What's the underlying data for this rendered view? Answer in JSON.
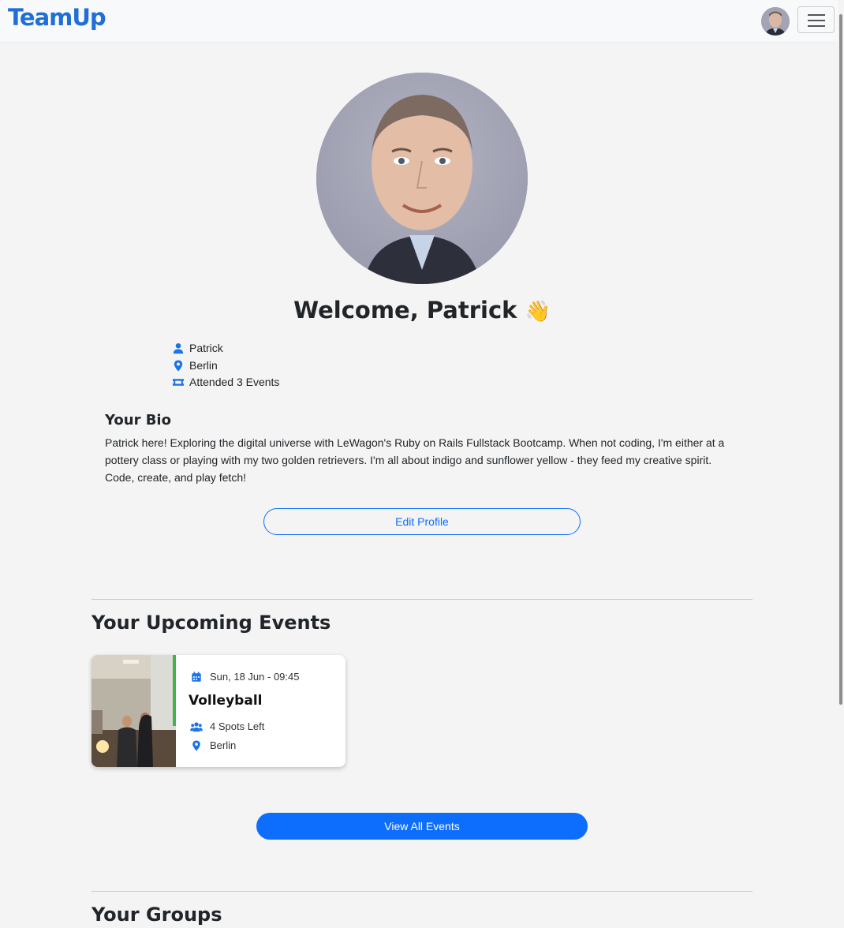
{
  "navbar": {
    "brand": "TeamUp"
  },
  "profile": {
    "welcome": "Welcome, Patrick",
    "wave_emoji": "👋",
    "info": [
      {
        "icon": "user-icon",
        "text": "Patrick"
      },
      {
        "icon": "location-pin-icon",
        "text": "Berlin"
      },
      {
        "icon": "ticket-icon",
        "text": "Attended 3 Events"
      }
    ],
    "bio_title": "Your Bio",
    "bio_text": "Patrick here! Exploring the digital universe with LeWagon's Ruby on Rails Fullstack Bootcamp. When not coding, I'm either at a pottery class or playing with my two golden retrievers. I'm all about indigo and sunflower yellow - they feed my creative spirit. Code, create, and play fetch!",
    "edit_button": "Edit Profile"
  },
  "upcoming": {
    "title": "Your Upcoming Events",
    "events": [
      {
        "date": "Sun, 18 Jun - 09:45",
        "title": "Volleyball",
        "spots": "4 Spots Left",
        "location": "Berlin"
      }
    ],
    "view_all_button": "View All Events"
  },
  "groups": {
    "title": "Your Groups"
  },
  "colors": {
    "brand": "#1f6fd6",
    "primary": "#0d6efd",
    "background": "#f4f4f4"
  }
}
